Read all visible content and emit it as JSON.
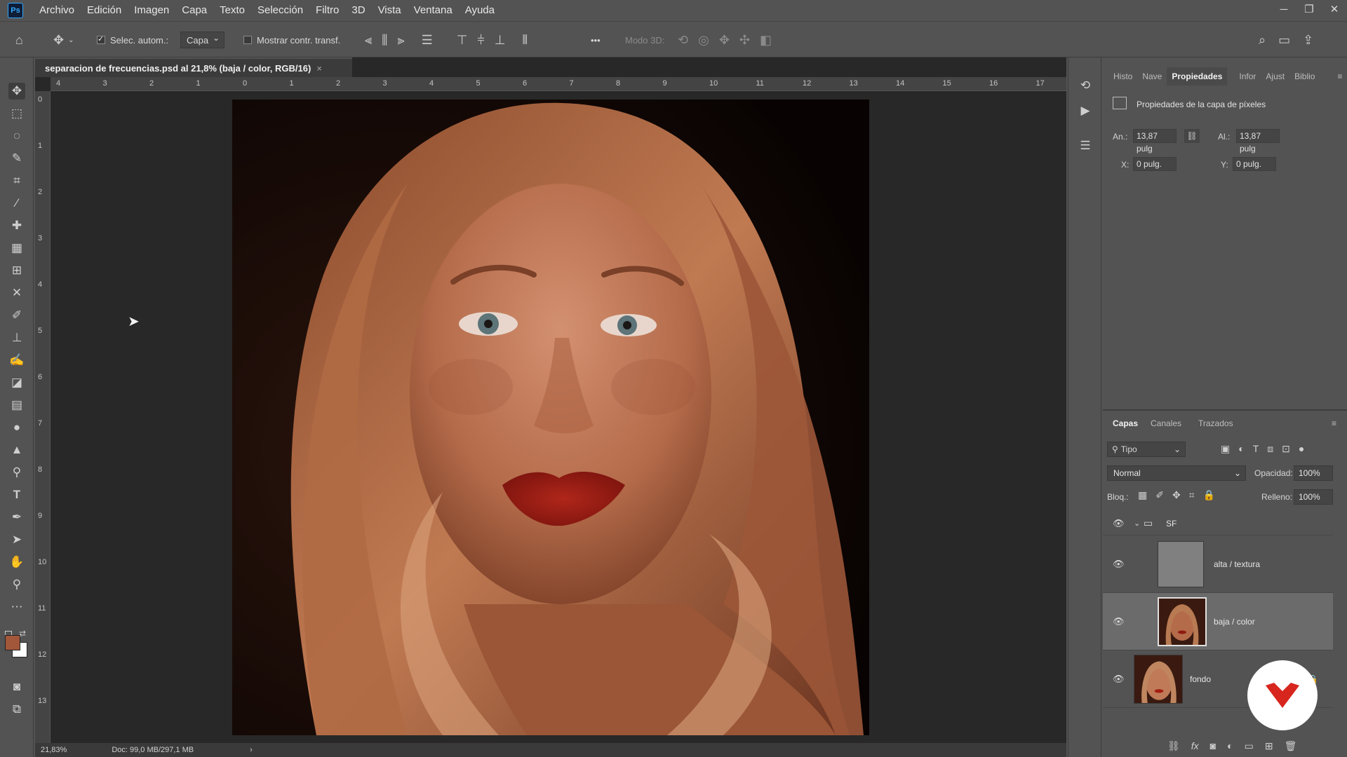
{
  "app": {
    "logo": "Ps"
  },
  "menu": [
    "Archivo",
    "Edición",
    "Imagen",
    "Capa",
    "Texto",
    "Selección",
    "Filtro",
    "3D",
    "Vista",
    "Ventana",
    "Ayuda"
  ],
  "window_controls": {
    "minimize": "─",
    "restore": "❐",
    "close": "✕"
  },
  "options": {
    "auto_select_label": "Selec. autom.:",
    "auto_select_value": "Capa",
    "show_transform_label": "Mostrar contr. transf.",
    "mode_3d_label": "Modo 3D:",
    "more": "•••"
  },
  "document": {
    "tab_title": "separacion de frecuencias.psd al 21,8% (baja / color, RGB/16)",
    "tab_close": "×",
    "zoom": "21,83%",
    "doc_size": "Doc: 99,0 MB/297,1 MB",
    "status_arrow": "›"
  },
  "rulers": {
    "h": [
      "4",
      "3",
      "2",
      "1",
      "0",
      "1",
      "2",
      "3",
      "4",
      "5",
      "6",
      "7",
      "8",
      "9",
      "10",
      "11",
      "12",
      "13",
      "14",
      "15",
      "16",
      "17"
    ],
    "v": [
      "0",
      "1",
      "2",
      "3",
      "4",
      "5",
      "6",
      "7",
      "8",
      "9",
      "1\n0",
      "1\n1",
      "1\n2",
      "1\n3"
    ]
  },
  "properties": {
    "tabs": [
      "Histo",
      "Nave",
      "Propiedades",
      "Infor",
      "Ajust",
      "Biblio"
    ],
    "active_tab": "Propiedades",
    "header": "Propiedades de la capa de píxeles",
    "width_label": "An.:",
    "width_value": "13,87 pulg",
    "height_label": "Al.:",
    "height_value": "13,87 pulg",
    "x_label": "X:",
    "x_value": "0 pulg.",
    "y_label": "Y:",
    "y_value": "0 pulg."
  },
  "layers_panel": {
    "tabs": [
      "Capas",
      "Canales",
      "Trazados"
    ],
    "filter_label": "Tipo",
    "blend_mode": "Normal",
    "opacity_label": "Opacidad:",
    "opacity_value": "100%",
    "lock_label": "Bloq.:",
    "fill_label": "Relleno:",
    "fill_value": "100%",
    "group_name": "SF",
    "layers": [
      {
        "name": "alta / textura",
        "selected": false
      },
      {
        "name": "baja / color",
        "selected": true
      },
      {
        "name": "fondo",
        "selected": false
      }
    ]
  },
  "colors": {
    "foreground": "#a2563a",
    "background": "#ffffff",
    "accent": "#31a8ff",
    "brand_badge": "#d7261e"
  }
}
